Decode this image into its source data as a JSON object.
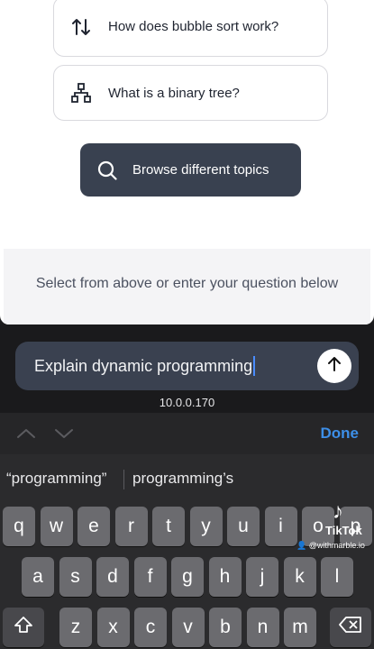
{
  "suggestions": [
    {
      "label": "How does bubble sort work?",
      "icon": "sort-arrows-icon"
    },
    {
      "label": "What is a binary tree?",
      "icon": "tree-icon"
    }
  ],
  "browse": {
    "label": "Browse different topics",
    "icon": "search-icon"
  },
  "hint": "Select from above or enter your question below",
  "input": {
    "value": "Explain dynamic programming",
    "send_icon": "arrow-up-icon"
  },
  "url": "10.0.0.170",
  "keyboard": {
    "done": "Done",
    "predictions": [
      "“programming”",
      "programming’s"
    ],
    "row1": [
      "q",
      "w",
      "e",
      "r",
      "t",
      "y",
      "u",
      "i",
      "o",
      "p"
    ],
    "row2": [
      "a",
      "s",
      "d",
      "f",
      "g",
      "h",
      "j",
      "k",
      "l"
    ],
    "row3": [
      "z",
      "x",
      "c",
      "v",
      "b",
      "n",
      "m"
    ]
  },
  "watermark": {
    "brand": "TikTok",
    "handle": "@withmarble.io"
  },
  "colors": {
    "button_bg": "#394150",
    "input_bg": "#3a4150",
    "done": "#3d8fe8",
    "key": "#6b6b6f"
  }
}
